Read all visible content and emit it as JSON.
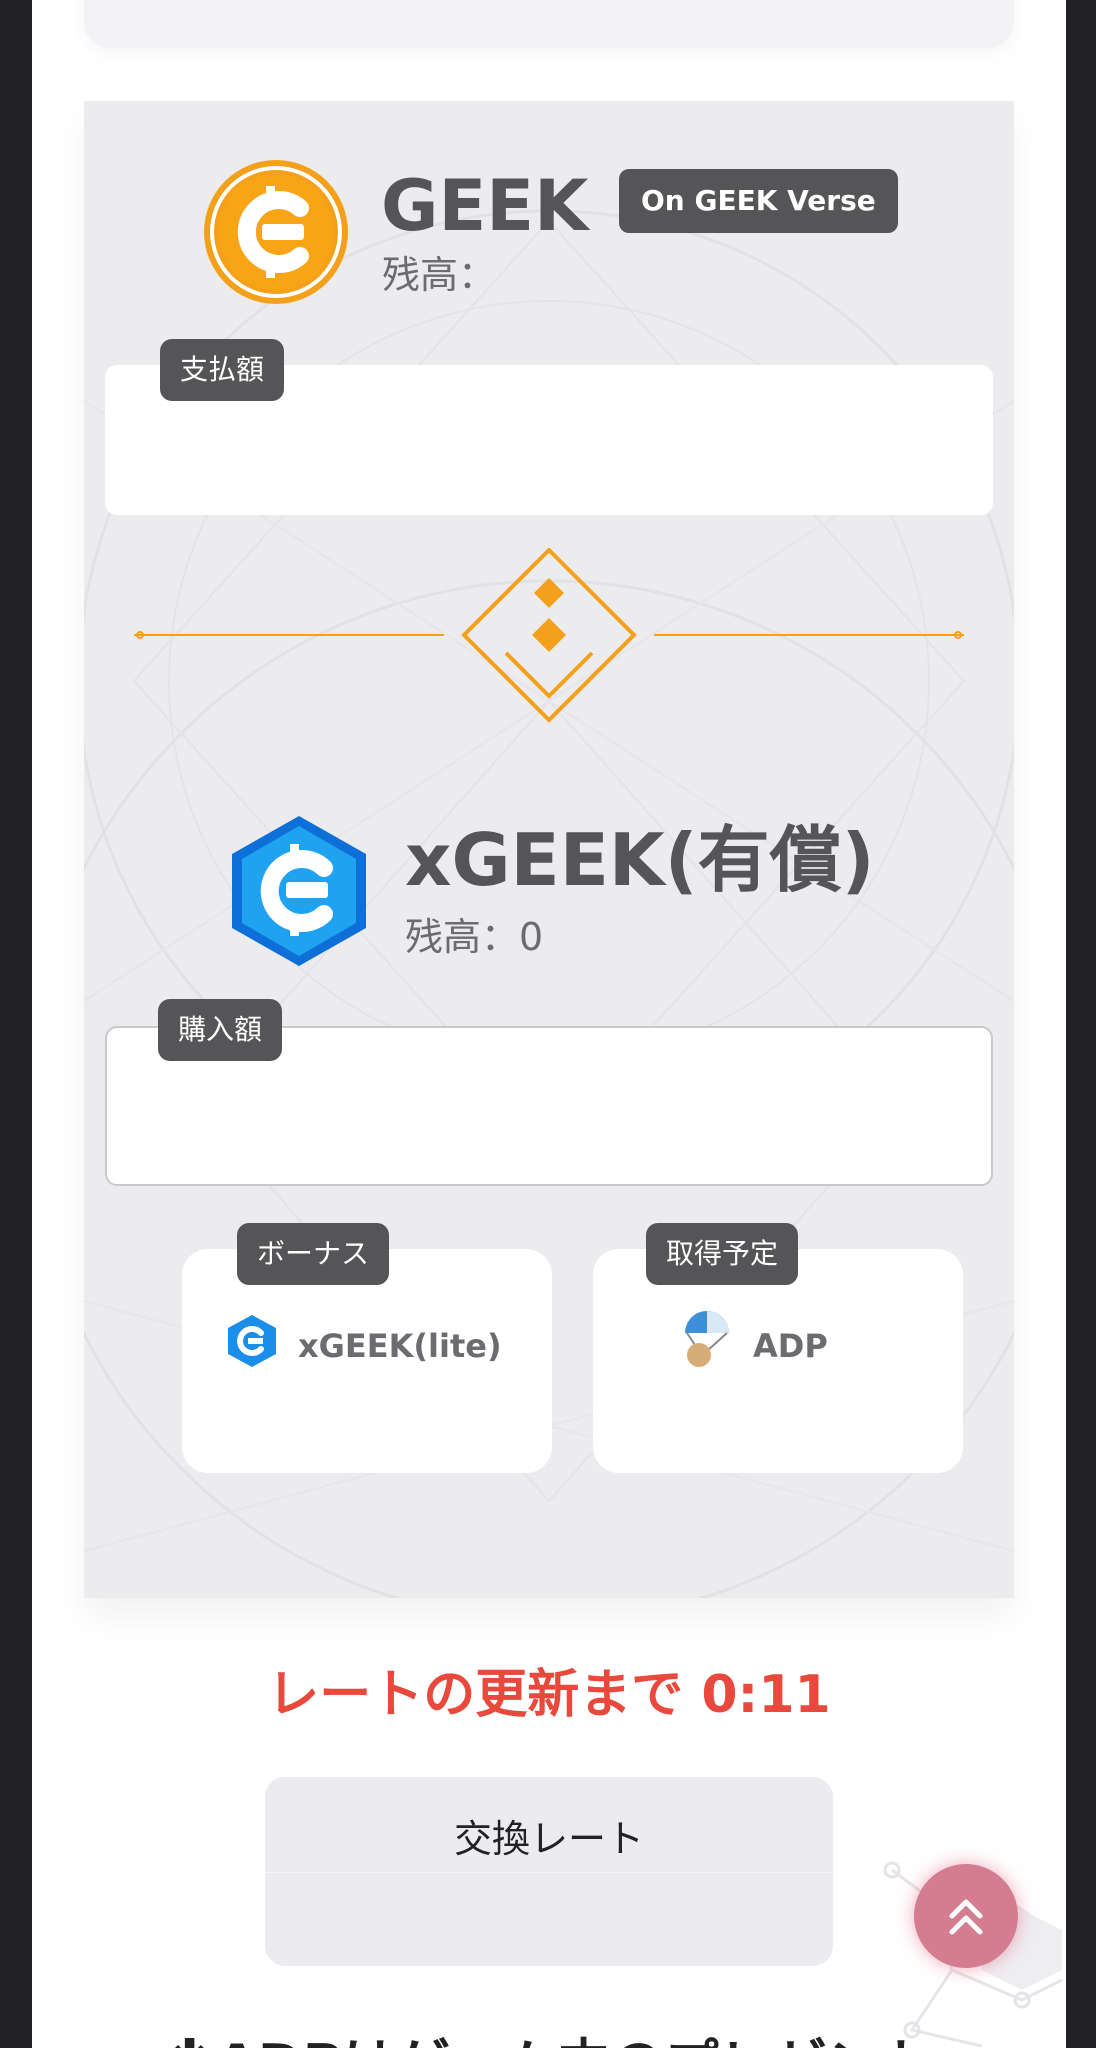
{
  "geek": {
    "name": "GEEK",
    "badge": "On GEEK Verse",
    "balance_label": "残高：",
    "balance_value": "",
    "pay_label": "支払額",
    "pay_value": ""
  },
  "xgeek": {
    "name": "xGEEK(有償)",
    "balance_label": "残高：",
    "balance_value": "0",
    "buy_label": "購入額",
    "buy_value": ""
  },
  "bonus": {
    "label": "ボーナス",
    "item": "xGEEK(lite)"
  },
  "acquire": {
    "label": "取得予定",
    "item": "ADP"
  },
  "rate": {
    "countdown": "レートの更新まで 0:11",
    "card_title": "交換レート"
  },
  "note": "※ADPはゲーム内のプレゼント",
  "colors": {
    "accent_orange": "#f5a01a",
    "accent_blue": "#1a8ee8",
    "countdown_red": "#e8493c",
    "badge_dark": "#555557",
    "scroll_button": "#d57d90"
  },
  "icons": {
    "geek_coin": "geek-coin-icon",
    "xgeek_coin": "xgeek-coin-icon",
    "swap": "swap-diamond-icon",
    "xgeek_lite": "xgeek-lite-icon",
    "adp": "adp-parachute-icon",
    "scroll_top": "double-chevron-up-icon"
  }
}
